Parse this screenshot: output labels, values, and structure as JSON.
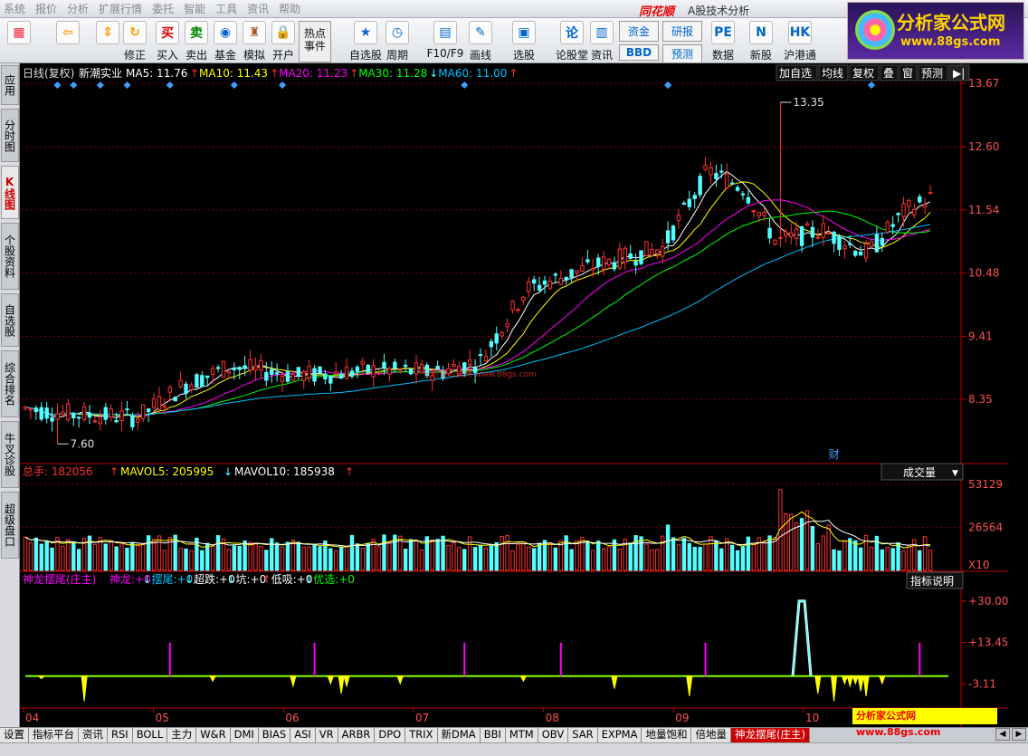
{
  "menubar": {
    "items": [
      "系统",
      "报价",
      "分析",
      "扩展行情",
      "委托",
      "智能",
      "工具",
      "资讯",
      "帮助"
    ],
    "brand": "同花顺",
    "title": "A股技术分析"
  },
  "toolbar": {
    "items": [
      {
        "name": "home",
        "label": "",
        "icon": "▦",
        "color": "#e23"
      },
      {
        "name": "back",
        "label": "",
        "icon": "⇦",
        "color": "#f90"
      },
      {
        "name": "updown",
        "label": "",
        "icon": "⇕",
        "color": "#f90"
      },
      {
        "name": "revise",
        "label": "修正",
        "icon": "↻",
        "color": "#f90"
      },
      {
        "name": "buy",
        "label": "买入",
        "icon": "买",
        "color": "#d00"
      },
      {
        "name": "sell",
        "label": "卖出",
        "icon": "卖",
        "color": "#080"
      },
      {
        "name": "fund",
        "label": "基金",
        "icon": "◉",
        "color": "#06c"
      },
      {
        "name": "simulate",
        "label": "模拟",
        "icon": "♜",
        "color": "#a52"
      },
      {
        "name": "open",
        "label": "开户",
        "icon": "🔒",
        "color": "#a80"
      },
      {
        "name": "hot",
        "label": "热点事件",
        "icon": "",
        "color": "#333"
      },
      {
        "name": "watchlist",
        "label": "自选股",
        "icon": "★",
        "color": "#06c"
      },
      {
        "name": "period",
        "label": "周期",
        "icon": "◷",
        "color": "#06c"
      },
      {
        "name": "f10",
        "label": "F10/F9",
        "icon": "▤",
        "color": "#06c"
      },
      {
        "name": "draw",
        "label": "画线",
        "icon": "✎",
        "color": "#06c"
      },
      {
        "name": "select",
        "label": "选股",
        "icon": "▣",
        "color": "#06c"
      },
      {
        "name": "forum",
        "label": "论股堂",
        "icon": "论",
        "color": "#06c"
      },
      {
        "name": "news",
        "label": "资讯",
        "icon": "▥",
        "color": "#06c"
      },
      {
        "name": "capital",
        "label": "资金",
        "icon": "",
        "color": "#06c"
      },
      {
        "name": "research",
        "label": "研报",
        "icon": "",
        "color": "#06c"
      },
      {
        "name": "data",
        "label": "数据",
        "icon": "PE",
        "color": "#06c"
      },
      {
        "name": "newstock",
        "label": "新股",
        "icon": "N",
        "color": "#06c"
      },
      {
        "name": "hkconnect",
        "label": "沪港通",
        "icon": "HK",
        "color": "#06c"
      }
    ],
    "bbd": "BBD",
    "forecast": "预测"
  },
  "logo": {
    "text1": "分析家公式网",
    "text2": "www.88gs.com"
  },
  "leftpanel": [
    "应用",
    "分时图",
    "K线图",
    "个股资料",
    "自选股",
    "综合排名",
    "牛叉诊股",
    "超级盘口"
  ],
  "chart_data": {
    "type": "candlestick",
    "header": {
      "period": "日线(复权)",
      "stock": "新潮实业",
      "ma": [
        {
          "name": "MA5",
          "value": "11.76",
          "arrow": "↑",
          "color": "#ffffff"
        },
        {
          "name": "MA10",
          "value": "11.43",
          "arrow": "↑",
          "color": "#ffff00"
        },
        {
          "name": "MA20",
          "value": "11.23",
          "arrow": "↑",
          "color": "#ff00ff"
        },
        {
          "name": "MA30",
          "value": "11.28",
          "arrow": "↓",
          "color": "#00ff00"
        },
        {
          "name": "MA60",
          "value": "11.00",
          "arrow": "↑",
          "color": "#00c0ff"
        }
      ],
      "buttons": [
        "加自选",
        "均线",
        "复权",
        "叠",
        "窗",
        "预测"
      ]
    },
    "price_axis": {
      "ticks": [
        13.67,
        12.6,
        11.54,
        10.48,
        9.41,
        8.35
      ],
      "ylim": [
        7.3,
        13.67
      ]
    },
    "price_high_label": "13.35",
    "price_low_label": "7.60",
    "x_ticks": [
      "04",
      "05",
      "06",
      "07",
      "08",
      "09",
      "10"
    ],
    "finance_marker": "财",
    "volume": {
      "title": "总手",
      "value": "182056",
      "mavol5": "205995",
      "mavol10": "185938",
      "arrows": [
        "↑",
        "↓",
        "↑"
      ],
      "selector": "成交量",
      "ticks": [
        "53129",
        "26564"
      ],
      "unit": "X10",
      "ylim": [
        0,
        56000
      ]
    },
    "indicator": {
      "name": "神龙摆尾(庄主)",
      "fields": [
        {
          "label": "神龙:",
          "value": "+0",
          "arrow": "↓",
          "color": "#ff00ff"
        },
        {
          "label": "摆尾:",
          "value": "+0",
          "arrow": "↓",
          "color": "#00c0ff"
        },
        {
          "label": "超跌:",
          "value": "+0",
          "arrow": "↓",
          "color": "#ffffff"
        },
        {
          "label": "坑:",
          "value": "+0",
          "arrow": "↑",
          "color": "#ffffff"
        },
        {
          "label": "低吸:",
          "value": "+0",
          "arrow": "↓",
          "color": "#ffffff"
        },
        {
          "label": "优选:",
          "value": "+0",
          "arrow": "",
          "color": "#00ff00"
        }
      ],
      "help": "指标说明",
      "ticks": [
        "+30.00",
        "+13.45",
        "-3.11"
      ],
      "ylim": [
        -12,
        35
      ]
    },
    "watermark": "分析家公式网 www.88gs.com",
    "price_watermark": "分析家公式网 www.88gs.com"
  },
  "bottomtabs": [
    "设置",
    "指标平台",
    "资讯",
    "RSI",
    "BOLL",
    "主力",
    "W&R",
    "DMI",
    "BIAS",
    "ASI",
    "VR",
    "ARBR",
    "DPO",
    "TRIX",
    "新DMA",
    "BBI",
    "MTM",
    "OBV",
    "SAR",
    "EXPMA",
    "地量饱和",
    "倍地量",
    "神龙摆尾(庄主)"
  ],
  "colors": {
    "up": "#ff3030",
    "down": "#54ffff",
    "grid": "#7a0000",
    "axis": "#c00000"
  }
}
